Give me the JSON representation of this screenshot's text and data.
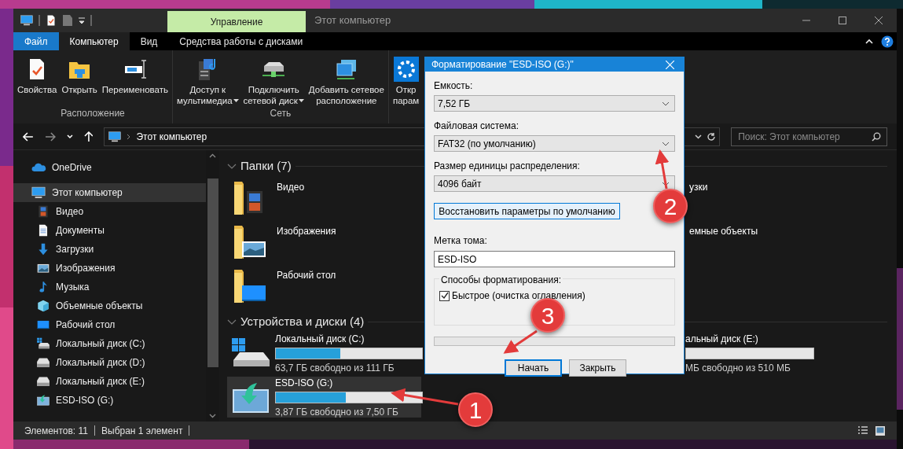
{
  "title_bar": {
    "context_tab": "Управление",
    "title": "Этот компьютер"
  },
  "ribbon_tabs": [
    {
      "label": "Файл",
      "kind": "file",
      "selected": false
    },
    {
      "label": "Компьютер",
      "kind": "tab",
      "selected": true
    },
    {
      "label": "Вид",
      "kind": "tab",
      "selected": false
    },
    {
      "label": "Средства работы с дисками",
      "kind": "tab",
      "selected": false
    }
  ],
  "ribbon_groups": [
    {
      "label": "Расположение",
      "buttons": [
        {
          "lines": [
            "Свойства"
          ],
          "kind": "properties",
          "dropdown": false
        },
        {
          "lines": [
            "Открыть"
          ],
          "kind": "open",
          "dropdown": false
        },
        {
          "lines": [
            "Переименовать"
          ],
          "kind": "rename",
          "dropdown": false
        }
      ]
    },
    {
      "label": "Сеть",
      "buttons": [
        {
          "lines": [
            "Доступ к",
            "мультимедиа"
          ],
          "kind": "media",
          "dropdown": true
        },
        {
          "lines": [
            "Подключить",
            "сетевой диск"
          ],
          "kind": "map_drive",
          "dropdown": true
        },
        {
          "lines": [
            "Добавить сетевое",
            "расположение"
          ],
          "kind": "add_location",
          "dropdown": false
        }
      ]
    },
    {
      "buttons": [
        {
          "lines": [
            "Откр",
            "парам"
          ],
          "kind": "settings",
          "dropdown": false
        }
      ]
    }
  ],
  "address": {
    "path": "Этот компьютер"
  },
  "search": {
    "placeholder": "Поиск: Этот компьютер"
  },
  "nav": [
    {
      "label": "OneDrive",
      "kind": "onedrive",
      "selected": false
    },
    {
      "label": "Этот компьютер",
      "kind": "pc",
      "selected": true,
      "children": [
        {
          "label": "Видео",
          "kind": "video",
          "selected": false
        },
        {
          "label": "Документы",
          "kind": "documents",
          "selected": false
        },
        {
          "label": "Загрузки",
          "kind": "downloads",
          "selected": false
        },
        {
          "label": "Изображения",
          "kind": "pictures",
          "selected": false
        },
        {
          "label": "Музыка",
          "kind": "music",
          "selected": false
        },
        {
          "label": "Объемные объекты",
          "kind": "objects3d",
          "selected": false
        },
        {
          "label": "Рабочий стол",
          "kind": "desktop",
          "selected": false
        },
        {
          "label": "Локальный диск (C:)",
          "kind": "drive_system",
          "selected": false
        },
        {
          "label": "Локальный диск (D:)",
          "kind": "drive",
          "selected": false
        },
        {
          "label": "Локальный диск (E:)",
          "kind": "drive",
          "selected": false
        },
        {
          "label": "ESD-ISO (G:)",
          "kind": "usb",
          "selected": false
        }
      ]
    }
  ],
  "folders": {
    "title": "Папки (7)",
    "expanded": true,
    "items": [
      {
        "label": "Видео",
        "kind": "video"
      },
      {
        "label": "узки",
        "kind": "partial"
      },
      {
        "label": "Изображения",
        "kind": "pictures"
      },
      {
        "label": "емные объекты",
        "kind": "partial"
      },
      {
        "label": "Рабочий стол",
        "kind": "desktop"
      }
    ]
  },
  "drives": {
    "title": "Устройства и диски (4)",
    "expanded": true,
    "items": [
      {
        "label": "Локальный диск (C:)",
        "free": "63,7 ГБ свободно из 111 ГБ",
        "kind": "drive_system",
        "level": 0.44,
        "selected": false
      },
      {
        "label": "альный диск (E:)",
        "free": "МБ свободно из 510 МБ",
        "kind": "partial",
        "selected": false
      },
      {
        "label": "ESD-ISO (G:)",
        "free": "3,87 ГБ свободно из 7,50 ГБ",
        "kind": "usb",
        "level": 0.48,
        "selected": true
      }
    ]
  },
  "status_bar": {
    "items": [
      "Элементов: 11",
      "Выбран 1 элемент"
    ]
  },
  "dialog": {
    "title": "Форматирование \"ESD-ISO (G:)\"",
    "combos": [
      {
        "label": "Емкость:",
        "value": "7,52 ГБ"
      },
      {
        "label": "Файловая система:",
        "value": "FAT32 (по умолчанию)"
      },
      {
        "label": "Размер единицы распределения:",
        "value": "4096 байт"
      }
    ],
    "restore_button": "Восстановить параметры по умолчанию",
    "volume_label": {
      "label": "Метка тома:",
      "value": "ESD-ISO"
    },
    "options": {
      "title": "Способы форматирования:",
      "checkbox": {
        "label": "Быстрое (очистка оглавления)",
        "checked": true
      }
    },
    "progress": {
      "level": 0
    },
    "buttons": [
      {
        "label": "Начать",
        "default": true
      },
      {
        "label": "Закрыть",
        "default": false
      }
    ]
  },
  "annotations": [
    {
      "label": "1"
    },
    {
      "label": "2"
    },
    {
      "label": "3"
    }
  ]
}
